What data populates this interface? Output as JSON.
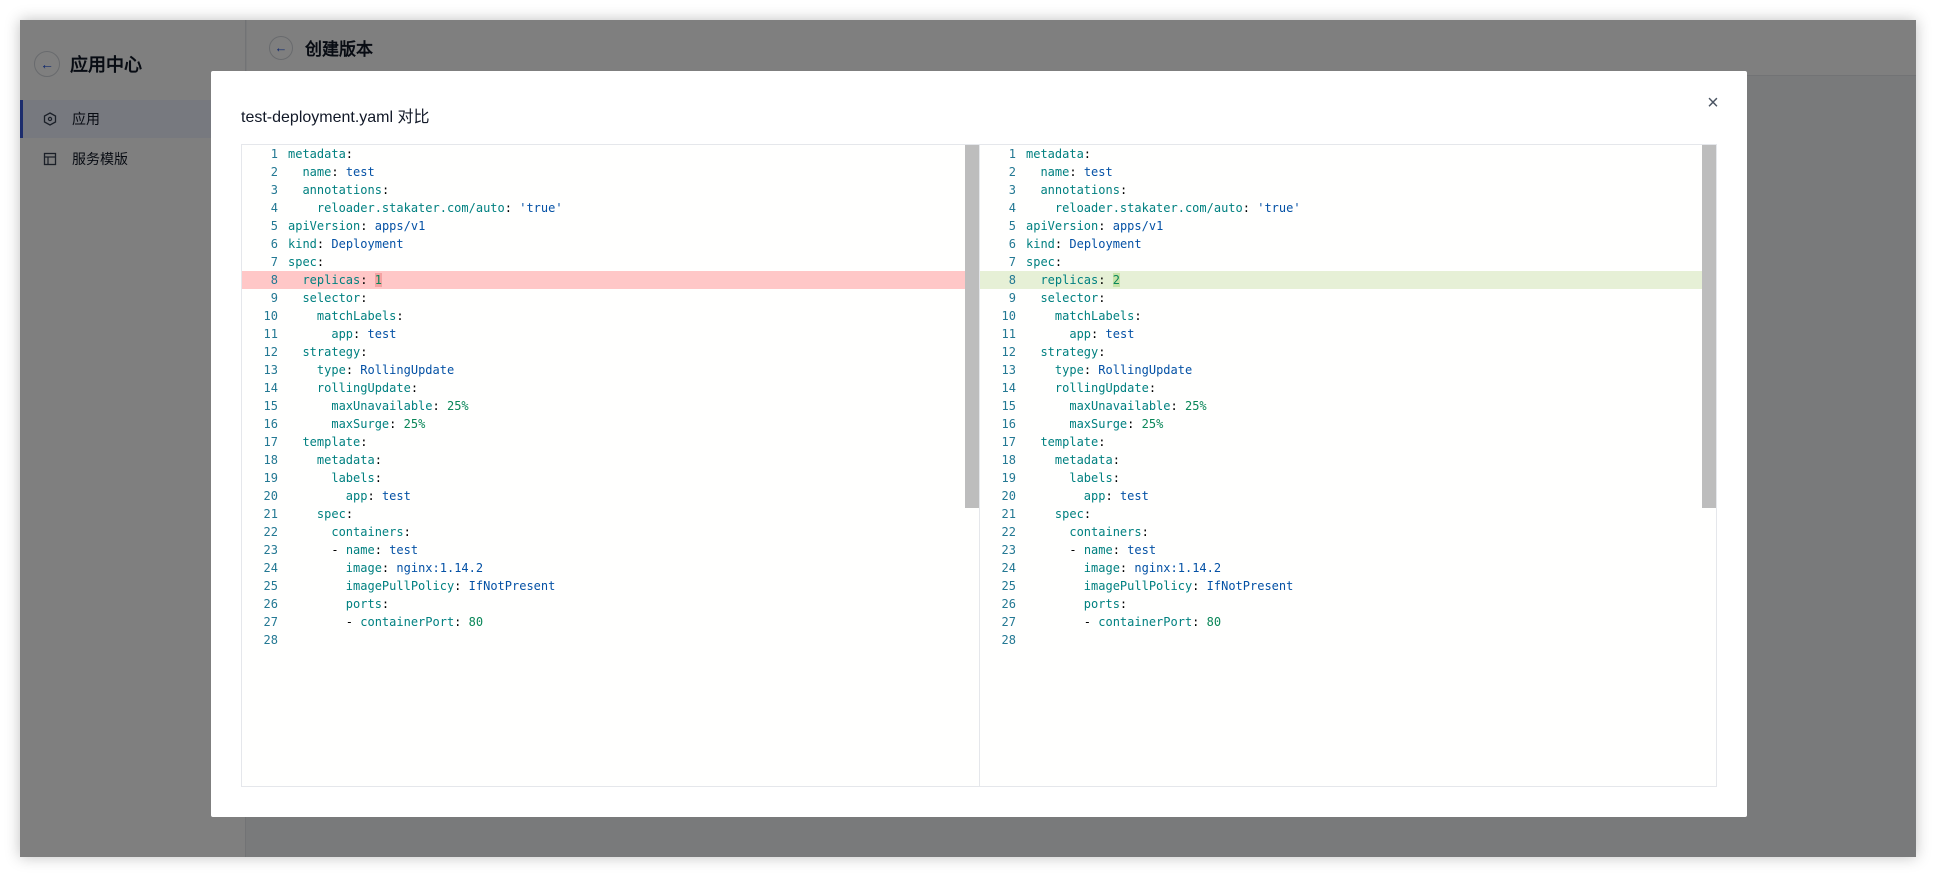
{
  "sidebar": {
    "title": "应用中心",
    "items": [
      {
        "label": "应用",
        "icon": "hexagon-icon",
        "active": true
      },
      {
        "label": "服务模版",
        "icon": "template-icon",
        "active": false
      }
    ]
  },
  "page": {
    "title": "创建版本"
  },
  "modal": {
    "title": "test-deployment.yaml 对比",
    "close": "×"
  },
  "diff": {
    "changed_line": 8,
    "left": [
      "metadata:",
      "  name: test",
      "  annotations:",
      "    reloader.stakater.com/auto: 'true'",
      "apiVersion: apps/v1",
      "kind: Deployment",
      "spec:",
      "  replicas: 1",
      "  selector:",
      "    matchLabels:",
      "      app: test",
      "  strategy:",
      "    type: RollingUpdate",
      "    rollingUpdate:",
      "      maxUnavailable: 25%",
      "      maxSurge: 25%",
      "  template:",
      "    metadata:",
      "      labels:",
      "        app: test",
      "    spec:",
      "      containers:",
      "      - name: test",
      "        image: nginx:1.14.2",
      "        imagePullPolicy: IfNotPresent",
      "        ports:",
      "        - containerPort: 80",
      ""
    ],
    "right": [
      "metadata:",
      "  name: test",
      "  annotations:",
      "    reloader.stakater.com/auto: 'true'",
      "apiVersion: apps/v1",
      "kind: Deployment",
      "spec:",
      "  replicas: 2",
      "  selector:",
      "    matchLabels:",
      "      app: test",
      "  strategy:",
      "    type: RollingUpdate",
      "    rollingUpdate:",
      "      maxUnavailable: 25%",
      "      maxSurge: 25%",
      "  template:",
      "    metadata:",
      "      labels:",
      "        app: test",
      "    spec:",
      "      containers:",
      "      - name: test",
      "        image: nginx:1.14.2",
      "        imagePullPolicy: IfNotPresent",
      "        ports:",
      "        - containerPort: 80",
      ""
    ]
  }
}
